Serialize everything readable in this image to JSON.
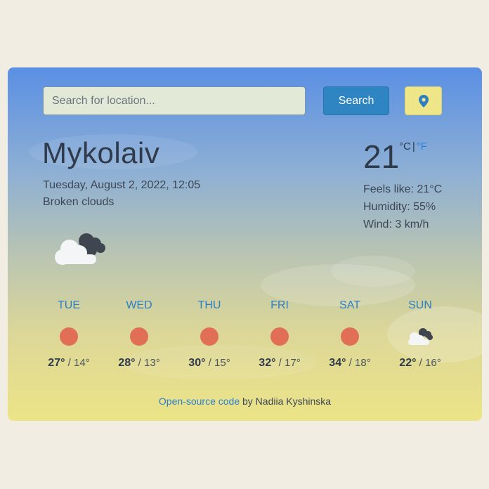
{
  "search": {
    "placeholder": "Search for location...",
    "value": "",
    "button_label": "Search"
  },
  "location_button": {
    "icon": "map-pin-icon"
  },
  "current": {
    "city": "Mykolaiv",
    "datetime": "Tuesday, August 2, 2022, 12:05",
    "description": "Broken clouds",
    "icon": "broken-clouds-icon",
    "temperature": "21",
    "unit_c": "°C",
    "unit_sep": "|",
    "unit_f": "°F",
    "feels_like": "Feels like: 21°C",
    "humidity": "Humidity: 55%",
    "wind": "Wind: 3 km/h"
  },
  "forecast": [
    {
      "day": "TUE",
      "max": "27°",
      "min": "/ 14°",
      "icon": "sun-icon"
    },
    {
      "day": "WED",
      "max": "28°",
      "min": "/ 13°",
      "icon": "sun-icon"
    },
    {
      "day": "THU",
      "max": "30°",
      "min": "/ 15°",
      "icon": "sun-icon"
    },
    {
      "day": "FRI",
      "max": "32°",
      "min": "/ 17°",
      "icon": "sun-icon"
    },
    {
      "day": "SAT",
      "max": "34°",
      "min": "/ 18°",
      "icon": "sun-icon"
    },
    {
      "day": "SUN",
      "max": "22°",
      "min": "/ 16°",
      "icon": "broken-clouds-icon"
    }
  ],
  "footer": {
    "link_text": "Open-source code",
    "text": " by Nadiia Kyshinska"
  },
  "colors": {
    "accent": "#2d7fc4",
    "sun": "#e06f55",
    "location_button": "#eee688",
    "search_button": "#2f84c2"
  }
}
